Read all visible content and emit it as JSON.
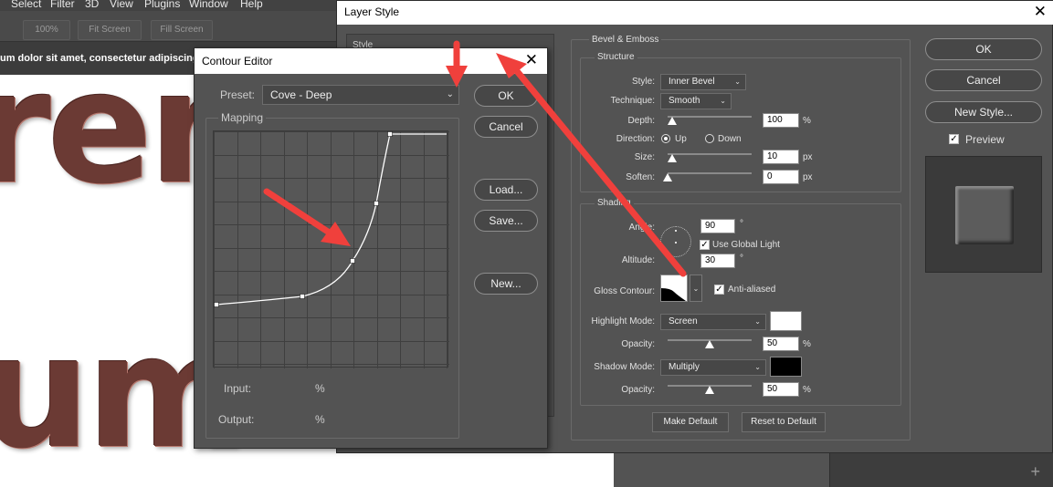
{
  "menu": [
    "Select",
    "Filter",
    "3D",
    "View",
    "Plugins",
    "Window",
    "Help"
  ],
  "options_bar": {
    "zoom": "100%",
    "fit_screen": "Fit Screen",
    "fill_screen": "Fill Screen"
  },
  "document_text": "um dolor sit amet, consectetur adipiscing",
  "canvas_text": {
    "line1": "rem",
    "line2": "um"
  },
  "layer_style": {
    "title": "Layer Style",
    "left_panel_label": "Style",
    "bevel_group": "Bevel & Emboss",
    "structure": {
      "group": "Structure",
      "style_label": "Style:",
      "style_value": "Inner Bevel",
      "technique_label": "Technique:",
      "technique_value": "Smooth",
      "depth_label": "Depth:",
      "depth_value": "100",
      "depth_unit": "%",
      "depth_level": 0.05,
      "direction_label": "Direction:",
      "direction_up": "Up",
      "direction_down": "Down",
      "size_label": "Size:",
      "size_value": "10",
      "size_unit": "px",
      "size_level": 0.05,
      "soften_label": "Soften:",
      "soften_value": "0",
      "soften_unit": "px",
      "soften_level": 0.0
    },
    "shading": {
      "group": "Shading",
      "angle_label": "Angle:",
      "angle_value": "90",
      "angle_unit": "°",
      "global_light": "Use Global Light",
      "altitude_label": "Altitude:",
      "altitude_value": "30",
      "altitude_unit": "°",
      "gloss_label": "Gloss Contour:",
      "anti_aliased": "Anti-aliased",
      "highlight_label": "Highlight Mode:",
      "highlight_value": "Screen",
      "highlight_color": "#ffffff",
      "hl_opacity_label": "Opacity:",
      "hl_opacity_value": "50",
      "hl_opacity_unit": "%",
      "hl_opacity_level": 0.5,
      "shadow_label": "Shadow Mode:",
      "shadow_value": "Multiply",
      "shadow_color": "#000000",
      "sh_opacity_label": "Opacity:",
      "sh_opacity_value": "50",
      "sh_opacity_unit": "%",
      "sh_opacity_level": 0.5
    },
    "make_default": "Make Default",
    "reset_default": "Reset to Default",
    "ok": "OK",
    "cancel": "Cancel",
    "new_style": "New Style...",
    "preview": "Preview"
  },
  "contour_editor": {
    "title": "Contour Editor",
    "preset_label": "Preset:",
    "preset_value": "Cove - Deep",
    "mapping": "Mapping",
    "ok": "OK",
    "cancel": "Cancel",
    "load": "Load...",
    "save": "Save...",
    "new": "New...",
    "input_label": "Input:",
    "input_unit": "%",
    "output_label": "Output:",
    "output_unit": "%"
  },
  "annotation_color": "#f0403c"
}
